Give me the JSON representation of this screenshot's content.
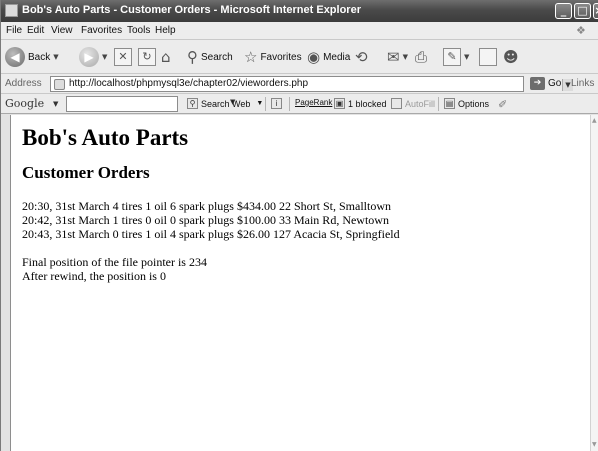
{
  "window": {
    "title": "Bob's Auto Parts - Customer Orders - Microsoft Internet Explorer"
  },
  "menu": [
    "File",
    "Edit",
    "View",
    "Favorites",
    "Tools",
    "Help"
  ],
  "toolbar": {
    "back": "Back",
    "search": "Search",
    "favorites": "Favorites",
    "media": "Media"
  },
  "address": {
    "label": "Address",
    "url": "http://localhost/phpmysql3e/chapter02/vieworders.php",
    "go": "Go",
    "links": "Links"
  },
  "google": {
    "logo": "Google",
    "search_web": "Search Web",
    "pagerank": "PageRank",
    "blocked": "1 blocked",
    "autofill": "AutoFill",
    "options": "Options"
  },
  "page": {
    "heading": "Bob's Auto Parts",
    "subheading": "Customer Orders",
    "orders": [
      "20:30, 31st March 4 tires 1 oil 6 spark plugs $434.00 22 Short St, Smalltown",
      "20:42, 31st March 1 tires 0 oil 0 spark plugs $100.00 33 Main Rd, Newtown",
      "20:43, 31st March 0 tires 1 oil 4 spark plugs $26.00 127 Acacia St, Springfield"
    ],
    "final_position": "Final position of the file pointer is 234",
    "after_rewind": "After rewind, the position is 0"
  }
}
